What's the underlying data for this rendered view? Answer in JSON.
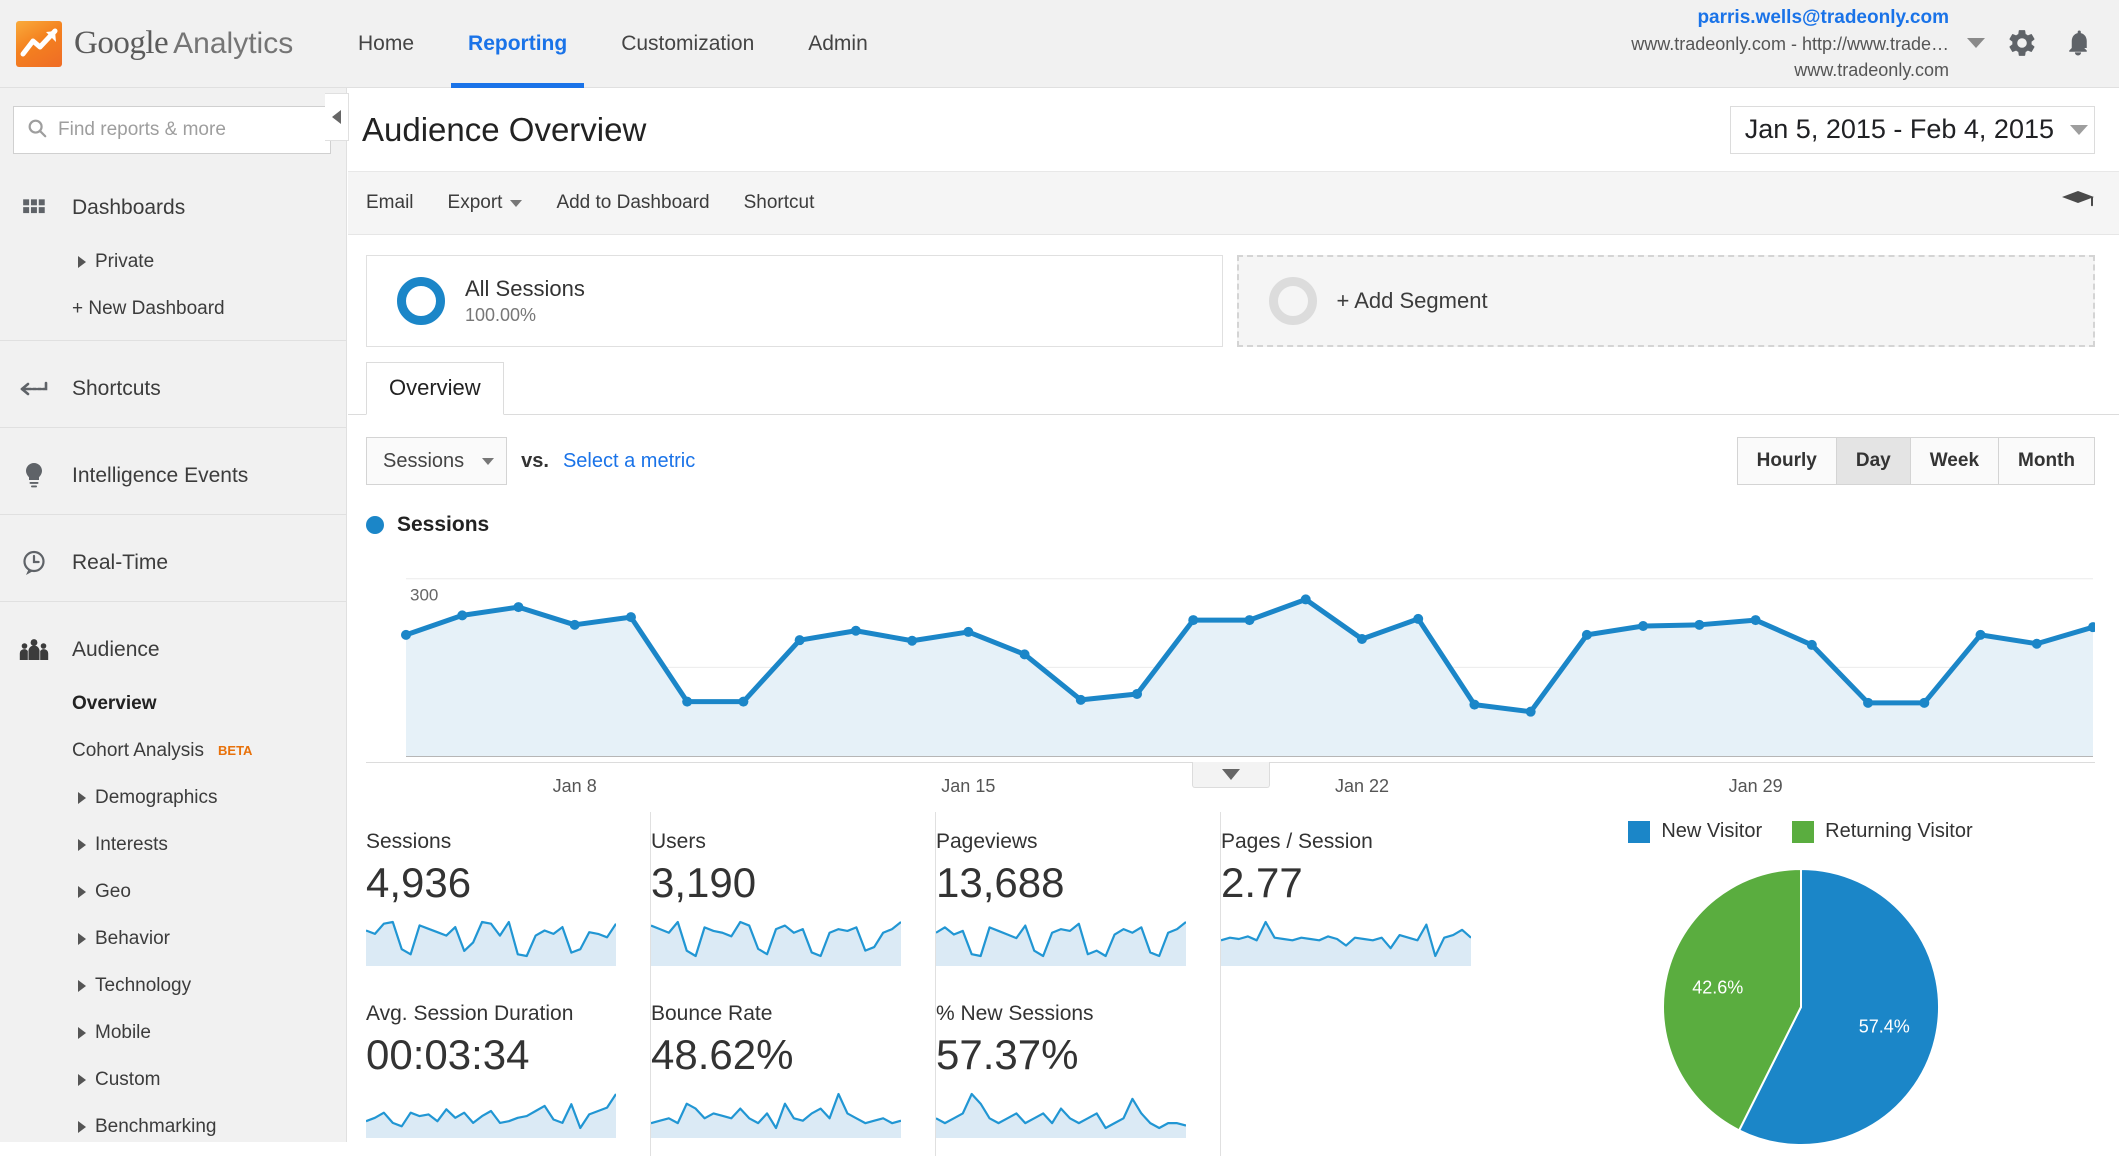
{
  "brand": {
    "google": "Google",
    "analytics": "Analytics",
    "logo_icon": "analytics-logo-icon"
  },
  "topnav": [
    {
      "label": "Home",
      "active": false
    },
    {
      "label": "Reporting",
      "active": true
    },
    {
      "label": "Customization",
      "active": false
    },
    {
      "label": "Admin",
      "active": false
    }
  ],
  "account": {
    "email": "parris.wells@tradeonly.com",
    "property": "www.tradeonly.com - http://www.trade…",
    "view": "www.tradeonly.com",
    "settings_icon": "gear-icon",
    "notifications_icon": "bell-icon",
    "dropdown_icon": "chevron-down-icon"
  },
  "sidebar": {
    "search": {
      "placeholder": "Find reports & more",
      "value": "",
      "icon": "search-icon"
    },
    "collapse_icon": "chevron-left-icon",
    "groups": [
      {
        "label": "Dashboards",
        "icon": "grid-icon",
        "children": [
          {
            "label": "Private",
            "expandable": true
          },
          {
            "label": "+ New Dashboard",
            "expandable": false
          }
        ]
      },
      {
        "label": "Shortcuts",
        "icon": "shortcut-arrow-icon",
        "children": []
      },
      {
        "label": "Intelligence Events",
        "icon": "lightbulb-icon",
        "children": []
      },
      {
        "label": "Real-Time",
        "icon": "clock-icon",
        "children": []
      },
      {
        "label": "Audience",
        "icon": "audience-people-icon",
        "children": [
          {
            "label": "Overview",
            "expandable": false,
            "selected": true
          },
          {
            "label": "Cohort Analysis",
            "expandable": false,
            "badge": "BETA"
          },
          {
            "label": "Demographics",
            "expandable": true
          },
          {
            "label": "Interests",
            "expandable": true
          },
          {
            "label": "Geo",
            "expandable": true
          },
          {
            "label": "Behavior",
            "expandable": true
          },
          {
            "label": "Technology",
            "expandable": true
          },
          {
            "label": "Mobile",
            "expandable": true
          },
          {
            "label": "Custom",
            "expandable": true
          },
          {
            "label": "Benchmarking",
            "expandable": true
          }
        ]
      }
    ]
  },
  "page": {
    "title": "Audience Overview",
    "date_range": "Jan 5, 2015 - Feb 4, 2015",
    "date_range_icon": "chevron-down-icon"
  },
  "actionbar": {
    "items": [
      {
        "label": "Email",
        "has_caret": false
      },
      {
        "label": "Export",
        "has_caret": true
      },
      {
        "label": "Add to Dashboard",
        "has_caret": false
      },
      {
        "label": "Shortcut",
        "has_caret": false
      }
    ],
    "help_icon": "graduation-cap-icon"
  },
  "segments": {
    "all_sessions": {
      "name": "All Sessions",
      "percent": "100.00%",
      "icon": "donut-icon"
    },
    "add_segment": {
      "label": "+ Add Segment",
      "icon": "donut-outline-icon"
    }
  },
  "tabs": [
    {
      "label": "Overview",
      "active": true
    }
  ],
  "metric_controls": {
    "primary_metric": "Sessions",
    "primary_caret": "chevron-down-icon",
    "vs_label": "vs.",
    "secondary_metric_link": "Select a metric",
    "granularity": [
      {
        "label": "Hourly",
        "active": false
      },
      {
        "label": "Day",
        "active": true
      },
      {
        "label": "Week",
        "active": false
      },
      {
        "label": "Month",
        "active": false
      }
    ]
  },
  "series_legend": {
    "label": "Sessions",
    "color": "#1b86c8"
  },
  "expand_handle_icon": "chevron-down-icon",
  "kpis": [
    {
      "label": "Sessions",
      "value": "4,936"
    },
    {
      "label": "Users",
      "value": "3,190"
    },
    {
      "label": "Pageviews",
      "value": "13,688"
    },
    {
      "label": "Pages / Session",
      "value": "2.77"
    },
    {
      "label": "Avg. Session Duration",
      "value": "00:03:34"
    },
    {
      "label": "Bounce Rate",
      "value": "48.62%"
    },
    {
      "label": "% New Sessions",
      "value": "57.37%"
    }
  ],
  "chart_data": [
    {
      "type": "area",
      "name": "sessions-over-time",
      "title": "Sessions",
      "xlabel": "",
      "ylabel": "",
      "ylim": [
        0,
        330
      ],
      "yticks": [
        150,
        300
      ],
      "grid": true,
      "legend_position": "top-left",
      "line_color": "#1b86c8",
      "fill_color": "#e6f1f8",
      "xtick_labels": [
        "Jan 8",
        "Jan 15",
        "Jan 22",
        "Jan 29"
      ],
      "xtick_indices": [
        3,
        10,
        17,
        24
      ],
      "x": [
        "Jan 5",
        "Jan 6",
        "Jan 7",
        "Jan 8",
        "Jan 9",
        "Jan 10",
        "Jan 11",
        "Jan 12",
        "Jan 13",
        "Jan 14",
        "Jan 15",
        "Jan 16",
        "Jan 17",
        "Jan 18",
        "Jan 19",
        "Jan 20",
        "Jan 21",
        "Jan 22",
        "Jan 23",
        "Jan 24",
        "Jan 25",
        "Jan 26",
        "Jan 27",
        "Jan 28",
        "Jan 29",
        "Jan 30",
        "Jan 31",
        "Feb 1",
        "Feb 2",
        "Feb 3",
        "Feb 4"
      ],
      "values": [
        205,
        238,
        252,
        222,
        235,
        92,
        92,
        196,
        212,
        195,
        210,
        172,
        95,
        105,
        230,
        230,
        265,
        198,
        232,
        87,
        75,
        205,
        220,
        222,
        230,
        188,
        90,
        90,
        205,
        190,
        218
      ]
    },
    {
      "type": "pie",
      "name": "new-vs-returning-visitors",
      "labels": [
        "New Visitor",
        "Returning Visitor"
      ],
      "values": [
        57.4,
        42.6
      ],
      "value_labels": [
        "57.4%",
        "42.6%"
      ],
      "colors": [
        "#1b86c8",
        "#5aad3f"
      ],
      "legend_position": "top"
    },
    {
      "type": "line",
      "name": "sparkline-sessions",
      "values": [
        62,
        58,
        70,
        72,
        40,
        34,
        68,
        64,
        60,
        56,
        66,
        38,
        48,
        72,
        70,
        56,
        72,
        34,
        32,
        56,
        62,
        58,
        66,
        36,
        40,
        60,
        58,
        54,
        70
      ]
    },
    {
      "type": "line",
      "name": "sparkline-users",
      "values": [
        66,
        62,
        58,
        70,
        38,
        32,
        64,
        60,
        58,
        54,
        70,
        66,
        40,
        34,
        62,
        66,
        58,
        62,
        36,
        32,
        58,
        62,
        60,
        64,
        38,
        42,
        58,
        62,
        70
      ]
    },
    {
      "type": "line",
      "name": "sparkline-pageviews",
      "values": [
        60,
        66,
        58,
        62,
        36,
        34,
        66,
        62,
        58,
        54,
        68,
        40,
        34,
        60,
        64,
        62,
        70,
        36,
        40,
        34,
        58,
        64,
        60,
        66,
        38,
        34,
        60,
        64,
        72
      ]
    },
    {
      "type": "line",
      "name": "sparkline-pages-per-session",
      "values": [
        54,
        56,
        55,
        57,
        54,
        68,
        56,
        55,
        54,
        56,
        55,
        54,
        57,
        55,
        50,
        56,
        55,
        54,
        56,
        48,
        58,
        56,
        54,
        66,
        42,
        56,
        58,
        62,
        56
      ]
    },
    {
      "type": "line",
      "name": "sparkline-avg-session-duration",
      "values": [
        46,
        50,
        56,
        44,
        40,
        56,
        52,
        54,
        46,
        60,
        50,
        56,
        44,
        52,
        58,
        44,
        46,
        50,
        52,
        58,
        64,
        48,
        44,
        66,
        38,
        54,
        58,
        62,
        78
      ]
    },
    {
      "type": "line",
      "name": "sparkline-bounce-rate",
      "values": [
        54,
        55,
        56,
        54,
        62,
        60,
        56,
        58,
        57,
        56,
        60,
        56,
        54,
        58,
        52,
        62,
        56,
        55,
        58,
        60,
        56,
        66,
        58,
        56,
        54,
        55,
        56,
        54,
        55
      ]
    },
    {
      "type": "line",
      "name": "sparkline-new-sessions",
      "values": [
        60,
        58,
        60,
        62,
        70,
        66,
        60,
        58,
        60,
        62,
        58,
        60,
        62,
        58,
        64,
        60,
        58,
        60,
        62,
        56,
        58,
        60,
        68,
        62,
        58,
        56,
        58,
        58,
        57
      ]
    }
  ]
}
